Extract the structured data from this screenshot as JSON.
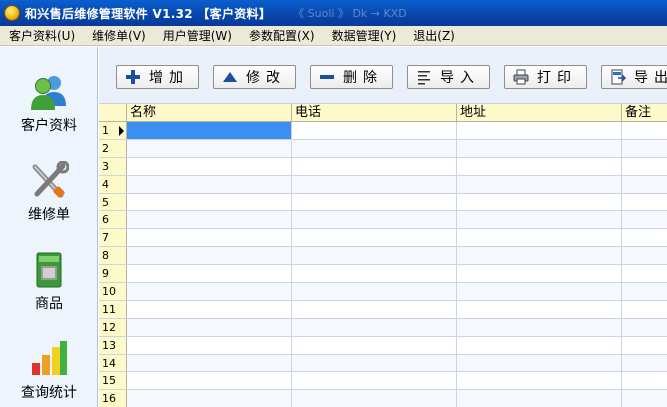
{
  "window": {
    "title": "和兴售后维修管理软件 V1.32 【客户资料】",
    "ghost_text": "《 Suoli 》 Dk → KXD"
  },
  "menu": [
    {
      "label": "客户资料(U)"
    },
    {
      "label": "维修单(V)"
    },
    {
      "label": "用户管理(W)"
    },
    {
      "label": "参数配置(X)"
    },
    {
      "label": "数据管理(Y)"
    },
    {
      "label": "退出(Z)"
    }
  ],
  "nav": [
    {
      "label": "客户资料",
      "icon": "users-icon"
    },
    {
      "label": "维修单",
      "icon": "tools-icon"
    },
    {
      "label": "商品",
      "icon": "product-icon"
    },
    {
      "label": "查询统计",
      "icon": "chart-icon"
    }
  ],
  "toolbar": {
    "add": "增加",
    "edit": "修改",
    "delete": "删除",
    "import": "导入",
    "print": "打印",
    "export": "导出"
  },
  "grid": {
    "columns": [
      "名称",
      "电话",
      "地址",
      "备注"
    ],
    "rows": [
      "1",
      "2",
      "3",
      "4",
      "5",
      "6",
      "7",
      "8",
      "9",
      "10",
      "11",
      "12",
      "13",
      "14",
      "15",
      "16"
    ],
    "selected_row": "1"
  },
  "colors": {
    "titlebar": "#0846a8",
    "grid_header": "#fdf9c9",
    "selected_cell": "#3b8ff0"
  }
}
